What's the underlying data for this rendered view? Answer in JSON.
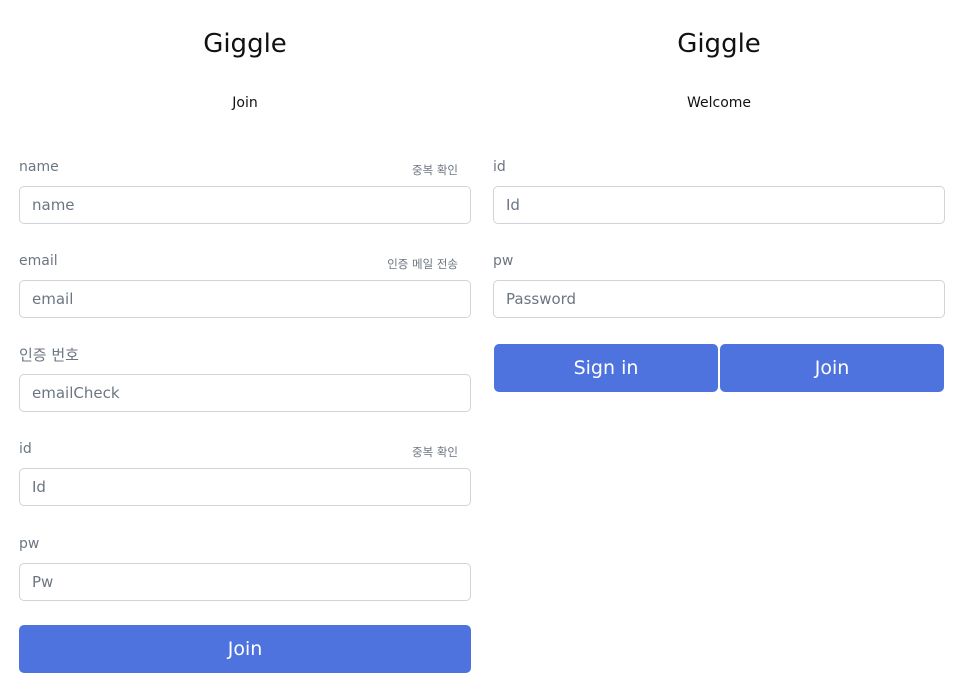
{
  "join_panel": {
    "title": "Giggle",
    "subtitle": "Join",
    "fields": [
      {
        "label": "name",
        "action": "중복 확인",
        "placeholder": "name"
      },
      {
        "label": "email",
        "action": "인증 메일 전송",
        "placeholder": "email"
      },
      {
        "label": "인증 번호",
        "placeholder": "emailCheck"
      },
      {
        "label": "id",
        "action": "중복 확인",
        "placeholder": "Id"
      },
      {
        "label": "pw",
        "placeholder": "Pw"
      }
    ],
    "join_button": "Join"
  },
  "login_panel": {
    "title": "Giggle",
    "subtitle": "Welcome",
    "fields": [
      {
        "label": "id",
        "placeholder": "Id"
      },
      {
        "label": "pw",
        "placeholder": "Password"
      }
    ],
    "signin_button": "Sign in",
    "join_button": "Join"
  },
  "colors": {
    "accent": "#4e73df",
    "label": "#6c7682",
    "border": "#ced4da"
  }
}
